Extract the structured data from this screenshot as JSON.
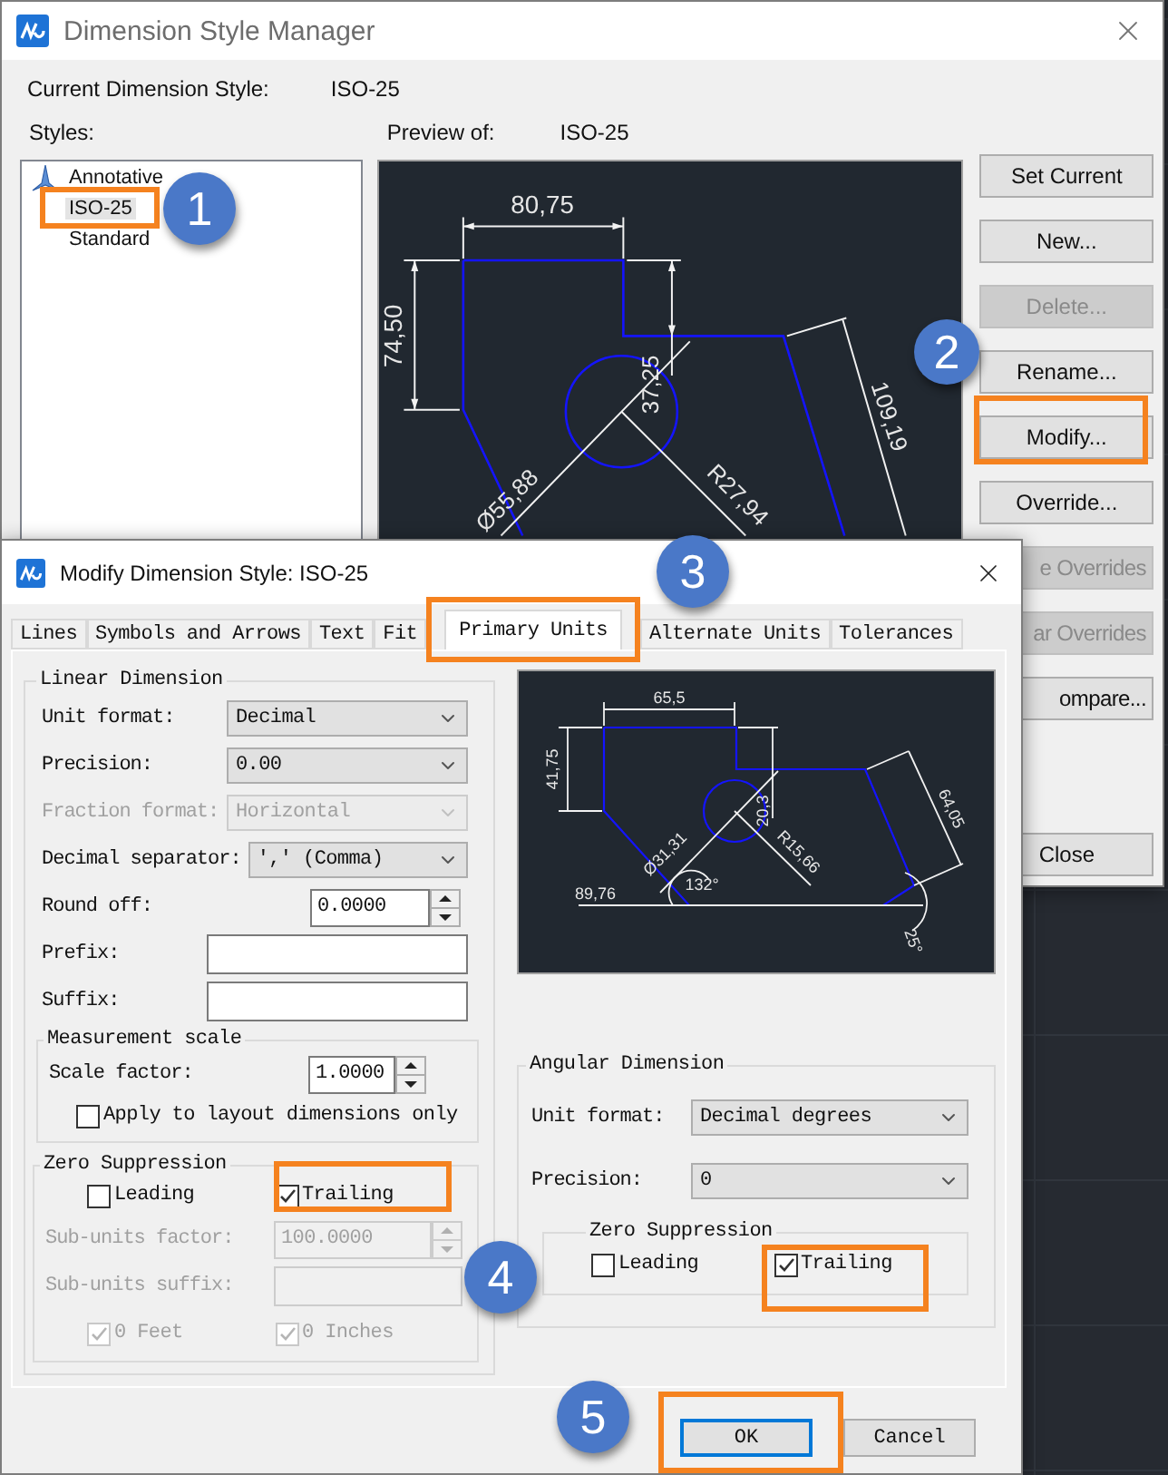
{
  "manager": {
    "title": "Dimension Style Manager",
    "current_label": "Current Dimension Style:",
    "current_value": "ISO-25",
    "styles_label": "Styles:",
    "styles": [
      {
        "label": "Annotative",
        "annotative": true,
        "selected": false
      },
      {
        "label": "ISO-25",
        "annotative": false,
        "selected": true
      },
      {
        "label": "Standard",
        "annotative": false,
        "selected": false
      }
    ],
    "preview_label": "Preview of:",
    "preview_value": "ISO-25",
    "preview_dimensions": [
      "80,75",
      "74,50",
      "37,25",
      "Ø55,88",
      "R27,94",
      "109,19"
    ],
    "buttons": [
      {
        "label": "Set Current",
        "disabled": false,
        "covered": false
      },
      {
        "label": "New...",
        "disabled": false,
        "covered": false
      },
      {
        "label": "Delete...",
        "disabled": true,
        "covered": false
      },
      {
        "label": "Rename...",
        "disabled": false,
        "covered": false
      },
      {
        "label": "Modify...",
        "disabled": false,
        "covered": false
      },
      {
        "label": "Override...",
        "disabled": false,
        "covered": false
      },
      {
        "label": "e Overrides",
        "disabled": true,
        "covered": true
      },
      {
        "label": "ar Overrides",
        "disabled": true,
        "covered": true
      },
      {
        "label": "ompare...",
        "disabled": false,
        "covered": true
      },
      {
        "label": "Close",
        "disabled": false,
        "covered": false
      }
    ]
  },
  "modify": {
    "title": "Modify Dimension Style: ISO-25",
    "tabs": [
      {
        "label": "Lines",
        "selected": false
      },
      {
        "label": "Symbols and Arrows",
        "selected": false
      },
      {
        "label": "Text",
        "selected": false
      },
      {
        "label": "Fit",
        "selected": false
      },
      {
        "label": "Primary Units",
        "selected": true
      },
      {
        "label": "Alternate Units",
        "selected": false
      },
      {
        "label": "Tolerances",
        "selected": false
      }
    ],
    "linear": {
      "title": "Linear Dimension",
      "fields": [
        {
          "kind": "select",
          "label": "Unit format:",
          "value": "Decimal",
          "disabled": false
        },
        {
          "kind": "select",
          "label": "Precision:",
          "value": "0.00",
          "disabled": false
        },
        {
          "kind": "select",
          "label": "Fraction format:",
          "value": "Horizontal",
          "disabled": true
        },
        {
          "kind": "select",
          "label": "Decimal separator:",
          "value": "',' (Comma)",
          "disabled": false
        },
        {
          "kind": "spin",
          "label": "Round off:",
          "value": "0.0000",
          "disabled": false
        },
        {
          "kind": "text",
          "label": "Prefix:",
          "disabled": false
        },
        {
          "kind": "text",
          "label": "Suffix:",
          "disabled": false
        }
      ],
      "measurement": {
        "title": "Measurement scale",
        "fields": [
          {
            "kind": "spin",
            "label": "Scale factor:",
            "value": "1.0000",
            "disabled": false
          }
        ],
        "checks": [
          {
            "label": "Apply to layout dimensions only",
            "checked": false,
            "disabled": false
          }
        ]
      },
      "zero": {
        "title": "Zero Suppression",
        "checks": [
          {
            "label": "Leading",
            "checked": false,
            "disabled": false
          },
          {
            "label": "Trailing",
            "checked": true,
            "disabled": false
          }
        ],
        "fields": [
          {
            "kind": "spin",
            "label": "Sub-units factor:",
            "value": "100.0000",
            "disabled": true
          },
          {
            "kind": "text",
            "label": "Sub-units suffix:",
            "disabled": true
          }
        ],
        "unit_checks": [
          {
            "label": "0 Feet",
            "checked": true,
            "disabled": true
          },
          {
            "label": "0 Inches",
            "checked": true,
            "disabled": true
          }
        ]
      }
    },
    "preview_dimensions": [
      "65,5",
      "41,75",
      "20,3",
      "Ø31,31",
      "R15,66",
      "64,05",
      "89,76",
      "132°",
      "25°"
    ],
    "angular": {
      "title": "Angular Dimension",
      "fields": [
        {
          "kind": "select",
          "label": "Unit format:",
          "value": "Decimal degrees",
          "disabled": false
        },
        {
          "kind": "select",
          "label": "Precision:",
          "value": "0",
          "disabled": false
        }
      ],
      "zero": {
        "title": "Zero Suppression",
        "checks": [
          {
            "label": "Leading",
            "checked": false,
            "disabled": false
          },
          {
            "label": "Trailing",
            "checked": true,
            "disabled": false
          }
        ]
      }
    },
    "buttons": [
      {
        "label": "OK",
        "default": true
      },
      {
        "label": "Cancel",
        "default": false
      }
    ]
  },
  "callouts": [
    "1",
    "2",
    "3",
    "4",
    "5"
  ]
}
